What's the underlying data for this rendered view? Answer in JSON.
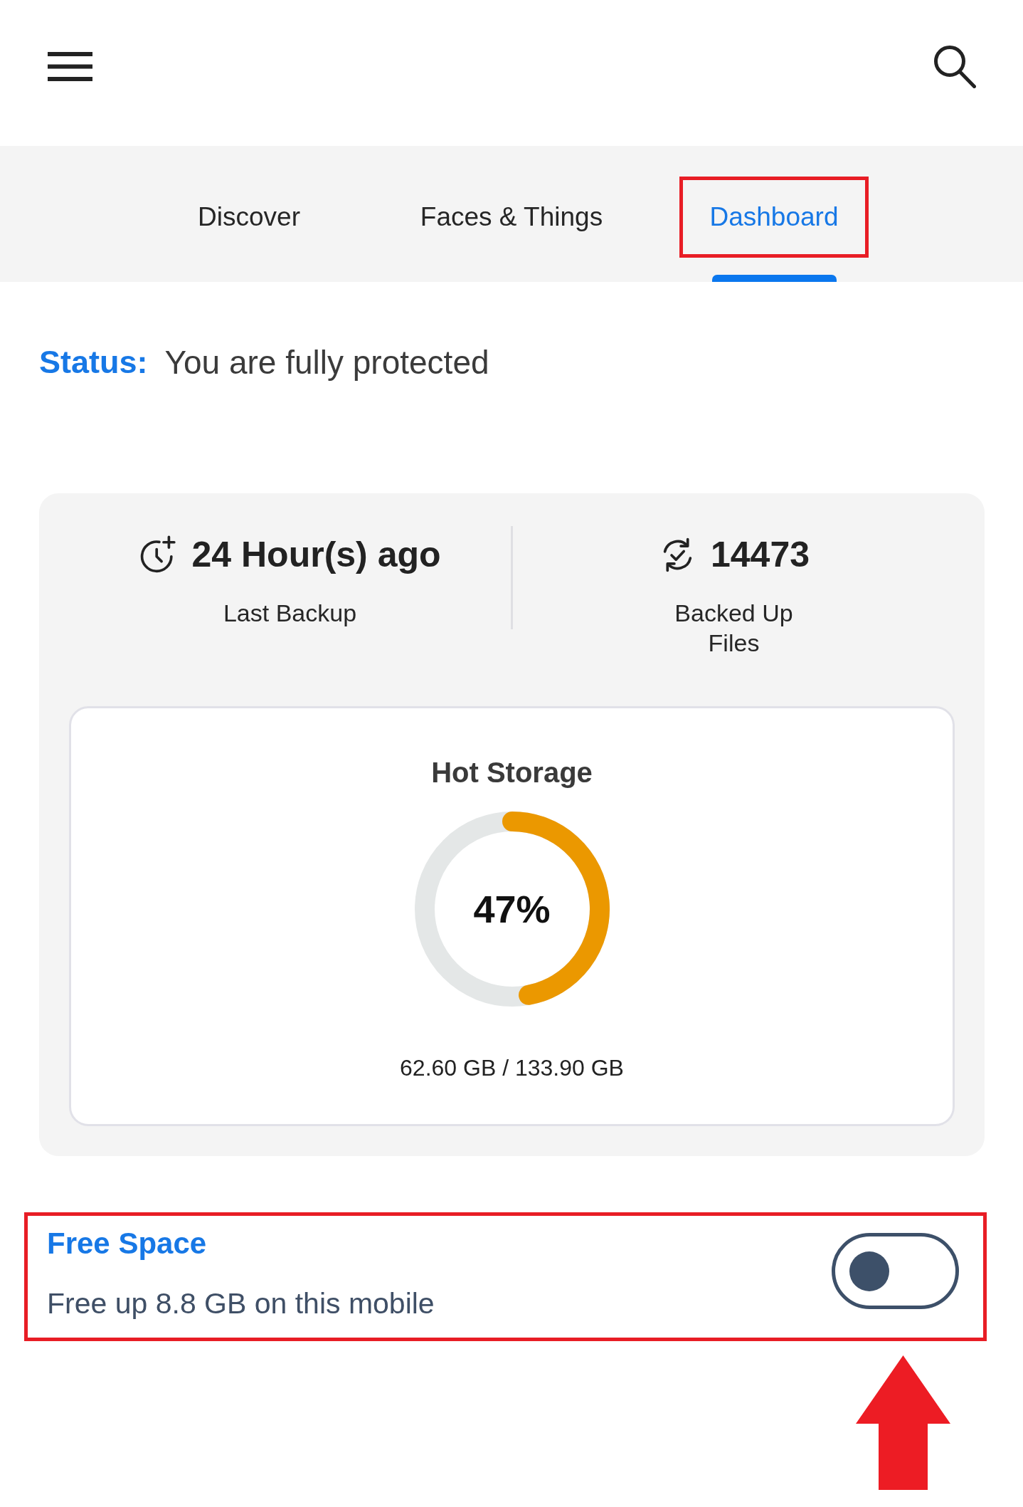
{
  "tabs": [
    {
      "label": "Discover",
      "selected": false,
      "highlighted": false
    },
    {
      "label": "Faces & Things",
      "selected": false,
      "highlighted": false
    },
    {
      "label": "Dashboard",
      "selected": true,
      "highlighted": true
    }
  ],
  "status": {
    "label": "Status:",
    "text": "You are fully protected"
  },
  "stats": [
    {
      "kind": "last_backup",
      "value": "24 Hour(s) ago",
      "label": "Last Backup"
    },
    {
      "kind": "backed_up_files",
      "value": "14473",
      "label": "Backed Up Files"
    }
  ],
  "hot_storage": {
    "title": "Hot Storage",
    "level": 0.47,
    "percent": "47%",
    "usage": "62.60 GB / 133.90 GB"
  },
  "free_space": {
    "title": "Free Space",
    "description": "Free up 8.8 GB on this mobile",
    "on": false,
    "highlighted": true,
    "annotation_arrow": true
  }
}
